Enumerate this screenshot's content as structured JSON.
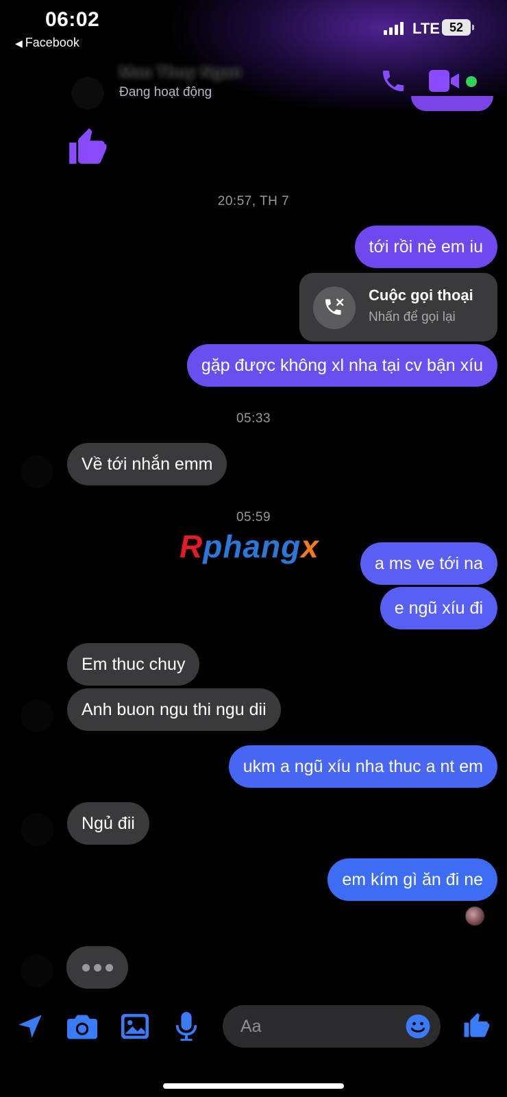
{
  "status_bar": {
    "time": "06:02",
    "back_app": "Facebook",
    "network": "LTE",
    "battery": "52"
  },
  "header": {
    "contact_name": "Mau Thuy Ngan",
    "contact_status": "Đang hoạt động"
  },
  "timestamps": [
    "20:57, TH 7",
    "05:33",
    "05:59"
  ],
  "messages": [
    {
      "side": "sent",
      "text": "tới rồi nè em iu"
    },
    {
      "side": "call",
      "title": "Cuộc gọi thoại",
      "subtitle": "Nhấn để gọi lại"
    },
    {
      "side": "sent",
      "text": "gặp được không xl nha tại cv bận xíu"
    },
    {
      "side": "received",
      "text": "Về tới nhắn emm"
    },
    {
      "side": "sent",
      "text": "a ms ve tới na"
    },
    {
      "side": "sent",
      "text": "e ngũ xíu đi"
    },
    {
      "side": "received",
      "text": "Em thuc chuy"
    },
    {
      "side": "received",
      "text": "Anh buon ngu thi ngu dii"
    },
    {
      "side": "sent",
      "text": "ukm a ngũ xíu nha thuc a nt em"
    },
    {
      "side": "received",
      "text": "Ngủ đii"
    },
    {
      "side": "sent",
      "text": "em kím gì ăn đi ne"
    }
  ],
  "watermark": {
    "part1": "R",
    "part2": "phang",
    "part3": "x"
  },
  "composer": {
    "placeholder": "Aa"
  },
  "colors": {
    "accent_purple": "#7a44e6",
    "bubble_gradient_top": "#6a4ff0",
    "bubble_gradient_bottom": "#3d6cf5",
    "received_bubble": "#3a3a3c",
    "composer_icons": "#3a7bf7",
    "online_dot": "#31d158"
  },
  "icons": [
    "phone-icon",
    "video-camera-icon",
    "thumbs-up-icon",
    "missed-call-icon",
    "location-arrow-icon",
    "camera-icon",
    "image-icon",
    "microphone-icon",
    "emoji-icon"
  ]
}
